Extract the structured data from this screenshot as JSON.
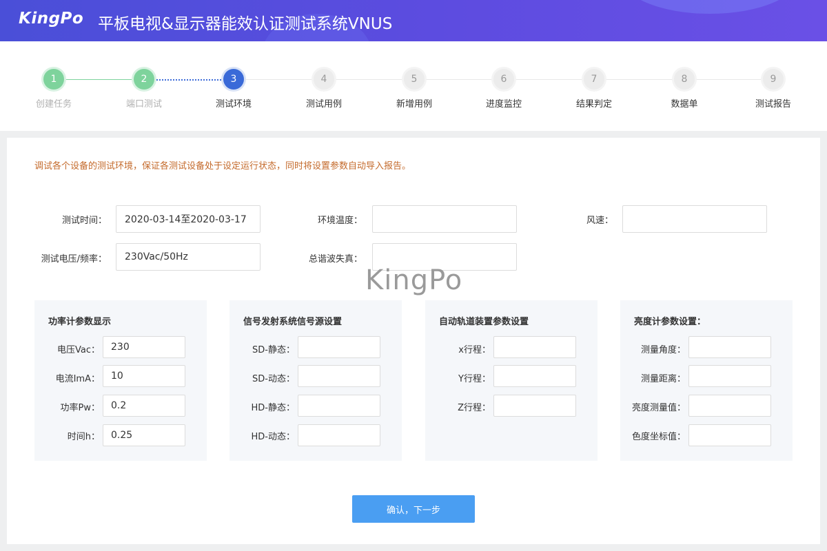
{
  "header": {
    "logo": "KingPo",
    "title": "平板电视&显示器能效认证测试系统VNUS"
  },
  "steps": [
    {
      "num": "1",
      "label": "创建任务",
      "state": "done"
    },
    {
      "num": "2",
      "label": "端口测试",
      "state": "done"
    },
    {
      "num": "3",
      "label": "测试环境",
      "state": "active"
    },
    {
      "num": "4",
      "label": "测试用例",
      "state": "todo"
    },
    {
      "num": "5",
      "label": "新增用例",
      "state": "todo"
    },
    {
      "num": "6",
      "label": "进度监控",
      "state": "todo"
    },
    {
      "num": "7",
      "label": "结果判定",
      "state": "todo"
    },
    {
      "num": "8",
      "label": "数据单",
      "state": "todo"
    },
    {
      "num": "9",
      "label": "测试报告",
      "state": "todo"
    }
  ],
  "notice": "调试各个设备的测试环境，保证各测试设备处于设定运行状态，同时将设置参数自动导入报告。",
  "fields": {
    "test_time": {
      "label": "测试时间：",
      "value": "2020-03-14至2020-03-17"
    },
    "env_temp": {
      "label": "环境温度：",
      "value": ""
    },
    "wind_speed": {
      "label": "风速：",
      "value": ""
    },
    "voltage_freq": {
      "label": "测试电压/频率：",
      "value": "230Vac/50Hz"
    },
    "thd": {
      "label": "总谐波失真：",
      "value": ""
    }
  },
  "watermark": "KingPo",
  "panels": [
    {
      "title": "功率计参数显示",
      "rows": [
        {
          "label": "电压Vac：",
          "value": "230"
        },
        {
          "label": "电流ImA：",
          "value": "10"
        },
        {
          "label": "功率Pw：",
          "value": "0.2"
        },
        {
          "label": "时间h：",
          "value": "0.25"
        }
      ]
    },
    {
      "title": "信号发射系统信号源设置",
      "rows": [
        {
          "label": "SD-静态：",
          "value": ""
        },
        {
          "label": "SD-动态：",
          "value": ""
        },
        {
          "label": "HD-静态：",
          "value": ""
        },
        {
          "label": "HD-动态：",
          "value": ""
        }
      ]
    },
    {
      "title": "自动轨道装置参数设置",
      "rows": [
        {
          "label": "x行程：",
          "value": ""
        },
        {
          "label": "Y行程：",
          "value": ""
        },
        {
          "label": "Z行程：",
          "value": ""
        }
      ]
    },
    {
      "title": "亮度计参数设置：",
      "rows": [
        {
          "label": "测量角度：",
          "value": ""
        },
        {
          "label": "测量距离：",
          "value": ""
        },
        {
          "label": "亮度测量值：",
          "value": ""
        },
        {
          "label": "色度坐标值：",
          "value": ""
        }
      ]
    }
  ],
  "confirm_label": "确认，下一步"
}
